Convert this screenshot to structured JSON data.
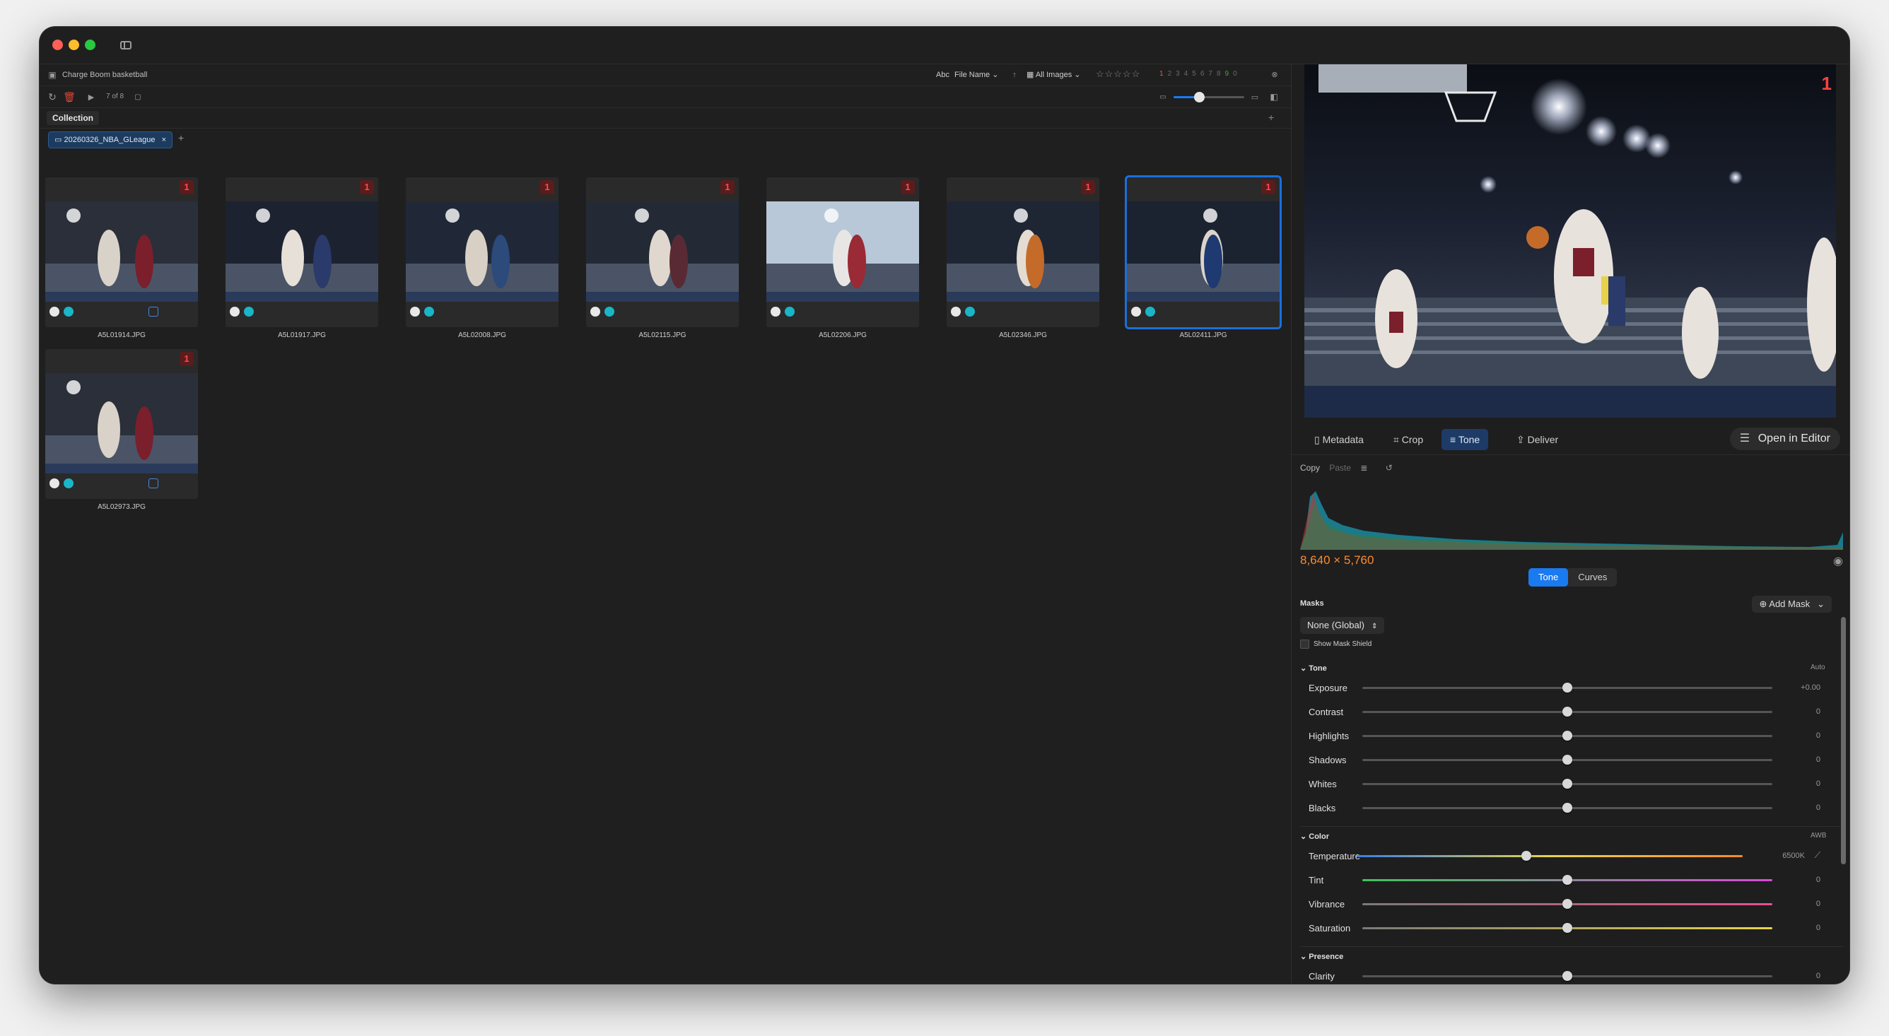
{
  "app": {
    "collection_name": "Charge Boom basketball",
    "count": "7 of 8",
    "sort_prefix": "Abc",
    "sort_label": "File Name",
    "filter_label": "All Images",
    "label_numbers": [
      "1",
      "2",
      "3",
      "4",
      "5",
      "6",
      "7",
      "8",
      "9",
      "0"
    ],
    "collection_tab": "Collection",
    "folder": "20260326_NBA_GLeague",
    "add_symbol": "+"
  },
  "thumbnails": [
    {
      "file": "A5L01914.JPG",
      "badge": "1",
      "flag": true,
      "selected": false
    },
    {
      "file": "A5L01917.JPG",
      "badge": "1",
      "flag": false,
      "selected": false
    },
    {
      "file": "A5L02008.JPG",
      "badge": "1",
      "flag": false,
      "selected": false
    },
    {
      "file": "A5L02115.JPG",
      "badge": "1",
      "flag": false,
      "selected": false
    },
    {
      "file": "A5L02206.JPG",
      "badge": "1",
      "flag": false,
      "selected": false
    },
    {
      "file": "A5L02346.JPG",
      "badge": "1",
      "flag": false,
      "selected": false
    },
    {
      "file": "A5L02411.JPG",
      "badge": "1",
      "flag": false,
      "selected": true
    },
    {
      "file": "A5L02973.JPG",
      "badge": "1",
      "flag": true,
      "selected": false
    }
  ],
  "preview": {
    "badge": "1"
  },
  "tabs": {
    "metadata": "Metadata",
    "crop": "Crop",
    "tone": "Tone",
    "deliver": "Deliver",
    "open_editor": "Open in Editor"
  },
  "copy": {
    "copy": "Copy",
    "paste": "Paste"
  },
  "histogram": {
    "dimensions": "8,640 × 5,760"
  },
  "mode": {
    "tone": "Tone",
    "curves": "Curves"
  },
  "masks": {
    "label": "Masks",
    "add": "Add Mask",
    "select": "None (Global)",
    "show_shield": "Show Mask Shield"
  },
  "groups": {
    "tone": {
      "title": "Tone",
      "right": "Auto"
    },
    "color": {
      "title": "Color",
      "right": "AWB"
    },
    "presence": {
      "title": "Presence"
    }
  },
  "sliders": {
    "tone": [
      {
        "label": "Exposure",
        "value": "+0.00",
        "pos": 0.5
      },
      {
        "label": "Contrast",
        "value": "0",
        "pos": 0.5
      },
      {
        "label": "Highlights",
        "value": "0",
        "pos": 0.5
      },
      {
        "label": "Shadows",
        "value": "0",
        "pos": 0.5
      },
      {
        "label": "Whites",
        "value": "0",
        "pos": 0.5
      },
      {
        "label": "Blacks",
        "value": "0",
        "pos": 0.5
      }
    ],
    "color": [
      {
        "label": "Temperature",
        "value": "6500K",
        "pos": 0.44
      },
      {
        "label": "Tint",
        "value": "0",
        "pos": 0.5
      },
      {
        "label": "Vibrance",
        "value": "0",
        "pos": 0.5
      },
      {
        "label": "Saturation",
        "value": "0",
        "pos": 0.5
      }
    ],
    "presence": [
      {
        "label": "Clarity",
        "value": "0",
        "pos": 0.5
      }
    ]
  },
  "colors": {
    "accent": "#1a7af0",
    "badge_red": "#ff4b4b",
    "dims_orange": "#ff8a2a",
    "teal": "#19b6c7"
  }
}
